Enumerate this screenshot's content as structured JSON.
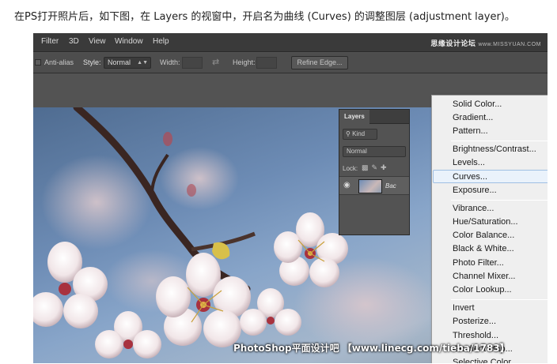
{
  "caption": "在PS打开照片后，如下图，在 Layers 的视窗中，开启名为曲线 (Curves) 的调整图层 (adjustment layer)。",
  "menubar": {
    "items": [
      "Filter",
      "3D",
      "View",
      "Window",
      "Help"
    ],
    "watermark": "思缘设计论坛",
    "watermark_site": "www.MISSYUAN.COM"
  },
  "options_bar": {
    "antialias": "Anti-alias",
    "style_label": "Style:",
    "style_value": "Normal",
    "width_label": "Width:",
    "height_label": "Height:",
    "refine_edge": "Refine Edge..."
  },
  "layers_panel": {
    "tab": "Layers",
    "kind": "Kind",
    "blend_mode": "Normal",
    "lock_label": "Lock:",
    "layer_name": "Bac"
  },
  "adjustment_menu": {
    "groups": [
      [
        "Solid Color...",
        "Gradient...",
        "Pattern..."
      ],
      [
        "Brightness/Contrast...",
        "Levels...",
        "Curves...",
        "Exposure..."
      ],
      [
        "Vibrance...",
        "Hue/Saturation...",
        "Color Balance...",
        "Black & White...",
        "Photo Filter...",
        "Channel Mixer...",
        "Color Lookup..."
      ],
      [
        "Invert",
        "Posterize...",
        "Threshold...",
        "Gradient Map...",
        "Selective Color..."
      ]
    ],
    "highlighted": "Curves..."
  },
  "watermark_bottom": "PhotoShop平面设计吧 【www.linecg.com/tieba/1783】",
  "colors": {
    "menubar": "#3a3a3a",
    "workspace": "#535353",
    "menu_bg": "#efefef",
    "highlight": "#eaf2fb"
  }
}
